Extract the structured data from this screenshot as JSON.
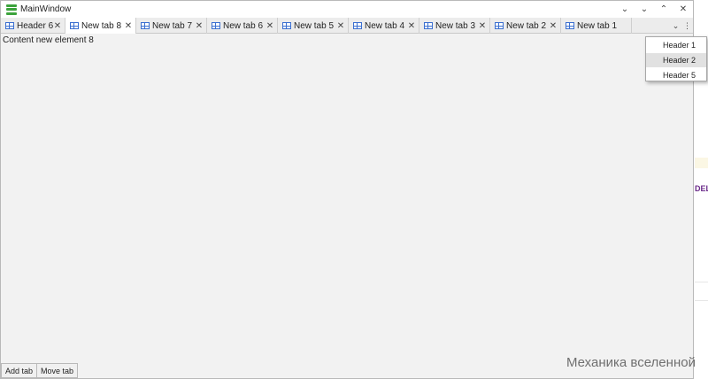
{
  "window": {
    "title": "MainWindow",
    "controls": [
      "⌄",
      "⌄",
      "⌃",
      "✕"
    ]
  },
  "tabs": [
    {
      "label": "Header 6",
      "active": false
    },
    {
      "label": "New tab  8",
      "active": true
    },
    {
      "label": "New tab  7",
      "active": false
    },
    {
      "label": "New tab  6",
      "active": false
    },
    {
      "label": "New tab  5",
      "active": false
    },
    {
      "label": "New tab  4",
      "active": false
    },
    {
      "label": "New tab  3",
      "active": false
    },
    {
      "label": "New tab  2",
      "active": false
    },
    {
      "label": "New tab  1",
      "active": false
    }
  ],
  "tab_tools": {
    "overflow": "⌄",
    "menu": "⋮"
  },
  "content": {
    "text": "Content new element 8"
  },
  "dropdown": {
    "items": [
      "Header 1",
      "Header 2",
      "Header 5"
    ],
    "highlighted_index": 1
  },
  "bottom": {
    "add_tab": "Add tab",
    "move_tab": "Move tab"
  },
  "watermark": "Механика вселенной",
  "background_fragment": "DELA"
}
